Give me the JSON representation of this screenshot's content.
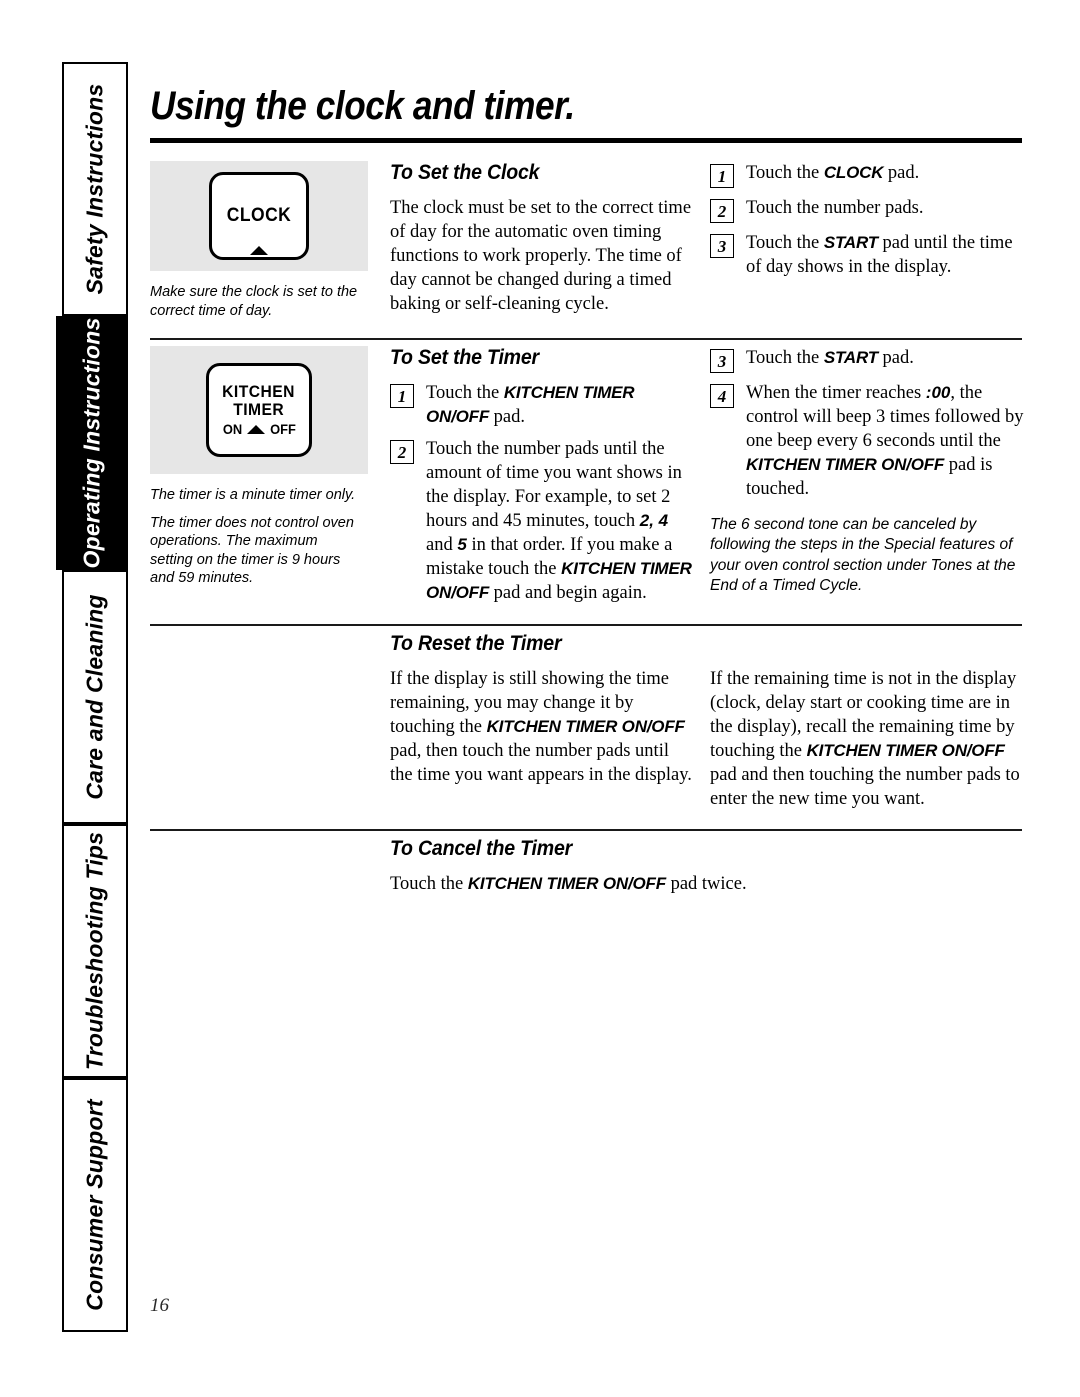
{
  "page": {
    "title": "Using the clock and timer.",
    "number": "16"
  },
  "sidebar": {
    "tabs": [
      {
        "label": "Safety Instructions",
        "active": false
      },
      {
        "label": "Operating Instructions",
        "active": true
      },
      {
        "label": "Care and Cleaning",
        "active": false
      },
      {
        "label": "Troubleshooting Tips",
        "active": false
      },
      {
        "label": "Consumer Support",
        "active": false
      }
    ]
  },
  "sections": {
    "set_clock": {
      "heading": "To Set the Clock",
      "pad": {
        "label": "CLOCK",
        "arrow": "up-triangle"
      },
      "pad_notes": [
        "Make sure the clock is set to the correct time of day."
      ],
      "body": "The clock must be set to the correct time of day for the automatic oven timing functions to work properly. The time of day cannot be changed during a timed baking or self-cleaning cycle.",
      "steps": [
        {
          "num": "1",
          "parts": [
            {
              "t": "Touch the ",
              "s": "plain"
            },
            {
              "t": "CLOCK",
              "s": "pad"
            },
            {
              "t": " pad.",
              "s": "plain"
            }
          ]
        },
        {
          "num": "2",
          "parts": [
            {
              "t": "Touch the number pads.",
              "s": "plain"
            }
          ]
        },
        {
          "num": "3",
          "parts": [
            {
              "t": "Touch the ",
              "s": "plain"
            },
            {
              "t": "START",
              "s": "pad"
            },
            {
              "t": " pad until the time of day shows in the display.",
              "s": "plain"
            }
          ]
        }
      ]
    },
    "set_timer": {
      "heading": "To Set the Timer",
      "pad": {
        "line1": "KITCHEN",
        "line2": "TIMER",
        "on_label": "ON",
        "off_label": "OFF",
        "arrow": "up-triangle"
      },
      "pad_notes": [
        "The timer is a minute timer only.",
        "The timer does not control oven operations. The maximum setting on the timer is 9 hours and 59 minutes."
      ],
      "steps_left": [
        {
          "num": "1",
          "parts": [
            {
              "t": "Touch the ",
              "s": "plain"
            },
            {
              "t": "KITCHEN TIMER ON/OFF",
              "s": "pad"
            },
            {
              "t": " pad.",
              "s": "plain"
            }
          ]
        },
        {
          "num": "2",
          "parts": [
            {
              "t": "Touch the number pads until the amount of time you want shows in the display. For example, to set 2 hours and 45 minutes, touch ",
              "s": "plain"
            },
            {
              "t": "2, 4",
              "s": "num"
            },
            {
              "t": " and ",
              "s": "plain"
            },
            {
              "t": "5",
              "s": "num"
            },
            {
              "t": " in that order. If you make a mistake touch the ",
              "s": "plain"
            },
            {
              "t": "KITCHEN TIMER ON/OFF",
              "s": "pad"
            },
            {
              "t": " pad and begin again.",
              "s": "plain"
            }
          ]
        }
      ],
      "steps_right": [
        {
          "num": "3",
          "parts": [
            {
              "t": "Touch the ",
              "s": "plain"
            },
            {
              "t": "START",
              "s": "pad"
            },
            {
              "t": " pad.",
              "s": "plain"
            }
          ]
        },
        {
          "num": "4",
          "parts": [
            {
              "t": "When the timer reaches ",
              "s": "plain"
            },
            {
              "t": ":00",
              "s": "num"
            },
            {
              "t": ", the control will beep 3 times followed by one beep every 6 seconds until the ",
              "s": "plain"
            },
            {
              "t": "KITCHEN TIMER ON/OFF",
              "s": "pad"
            },
            {
              "t": " pad is touched.",
              "s": "plain"
            }
          ]
        }
      ],
      "note": "The 6 second tone can be canceled by following the steps in the Special features of your oven control section under Tones at the End of a Timed Cycle."
    },
    "reset_timer": {
      "heading": "To Reset the Timer",
      "left_parts": [
        {
          "t": "If the display is still showing the time remaining, you may change it by touching the ",
          "s": "plain"
        },
        {
          "t": "KITCHEN TIMER ON/OFF",
          "s": "pad"
        },
        {
          "t": " pad, then touch the number pads until the time you want appears in the display.",
          "s": "plain"
        }
      ],
      "right_parts": [
        {
          "t": "If the remaining time is not in the display (clock, delay start or cooking time are in the display), recall the remaining time by touching the ",
          "s": "plain"
        },
        {
          "t": "KITCHEN TIMER ON/OFF",
          "s": "pad"
        },
        {
          "t": " pad and then touching the number pads to enter the new time you want.",
          "s": "plain"
        }
      ]
    },
    "cancel_timer": {
      "heading": "To Cancel the Timer",
      "parts": [
        {
          "t": "Touch the ",
          "s": "plain"
        },
        {
          "t": "KITCHEN TIMER ON/OFF",
          "s": "pad"
        },
        {
          "t": " pad twice.",
          "s": "plain"
        }
      ]
    }
  },
  "colors": {
    "panel_gray": "#e6e6e6",
    "ink": "#000000",
    "active_tab_bg": "#000000",
    "active_tab_text": "#ffffff"
  }
}
